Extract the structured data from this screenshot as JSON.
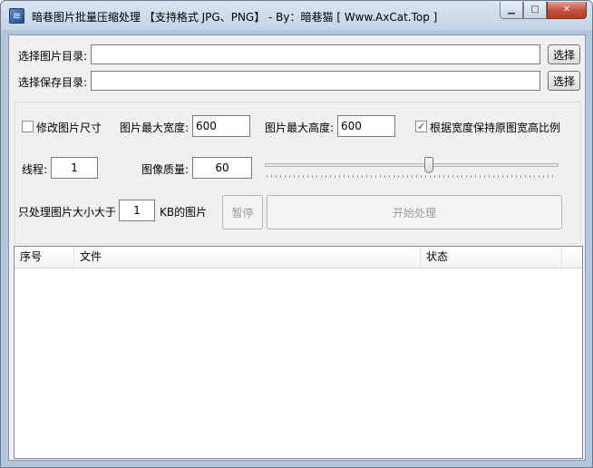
{
  "window": {
    "title": "暗巷图片批量压缩处理 【支持格式 JPG、PNG】 - By：暗巷猫 [ Www.AxCat.Top ]",
    "icon": "app-icon"
  },
  "form": {
    "source_dir_label": "选择图片目录:",
    "source_dir_value": "",
    "source_browse_label": "选择",
    "save_dir_label": "选择保存目录:",
    "save_dir_value": "",
    "save_browse_label": "选择",
    "resize_checkbox_label": "修改图片尺寸",
    "resize_checked": false,
    "max_width_label": "图片最大宽度:",
    "max_width_value": "600",
    "max_height_label": "图片最大高度:",
    "max_height_value": "600",
    "keep_ratio_label": "根据宽度保持原图宽高比例",
    "keep_ratio_checked": true,
    "threads_label": "线程:",
    "threads_value": "1",
    "quality_label": "图像质量:",
    "quality_value": "60",
    "quality_slider_fraction": 0.56,
    "min_size_prefix": "只处理图片大小大于",
    "min_size_value": "1",
    "min_size_suffix": "KB的图片",
    "pause_label": "暂停",
    "start_label": "开始处理"
  },
  "list": {
    "columns": [
      "序号",
      "文件",
      "状态"
    ],
    "rows": []
  }
}
